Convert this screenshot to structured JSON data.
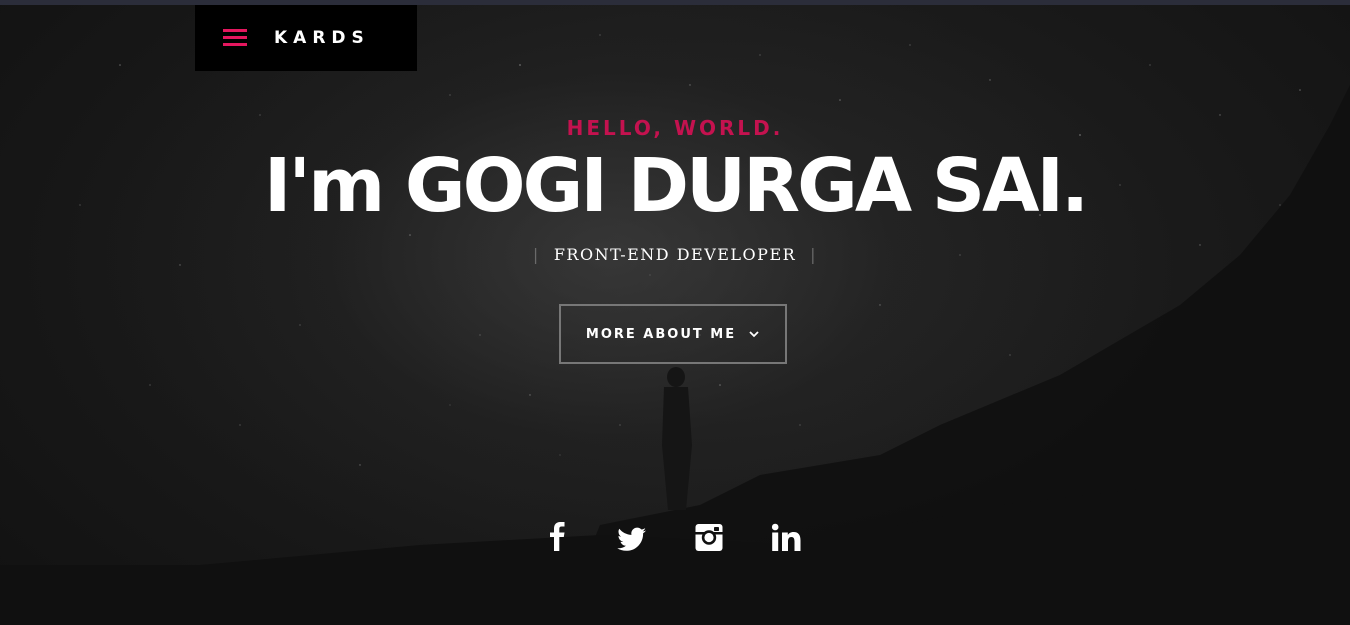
{
  "header": {
    "logo": "KARDS",
    "menu_icon": "hamburger-menu-icon"
  },
  "hero": {
    "greeting": "HELLO, WORLD.",
    "name": "I'm GOGI DURGA SAI.",
    "role": "FRONT-END DEVELOPER",
    "role_separator": "|",
    "cta_label": "MORE ABOUT ME",
    "cta_icon": "chevron-down-icon"
  },
  "social": [
    {
      "name": "facebook",
      "icon": "facebook-icon"
    },
    {
      "name": "twitter",
      "icon": "twitter-icon"
    },
    {
      "name": "instagram",
      "icon": "instagram-icon"
    },
    {
      "name": "linkedin",
      "icon": "linkedin-icon"
    }
  ],
  "colors": {
    "accent": "#e5175f",
    "greeting": "#c4124f",
    "background": "#111111",
    "header_bg": "#000000",
    "text": "#ffffff",
    "button_border": "#777777"
  }
}
